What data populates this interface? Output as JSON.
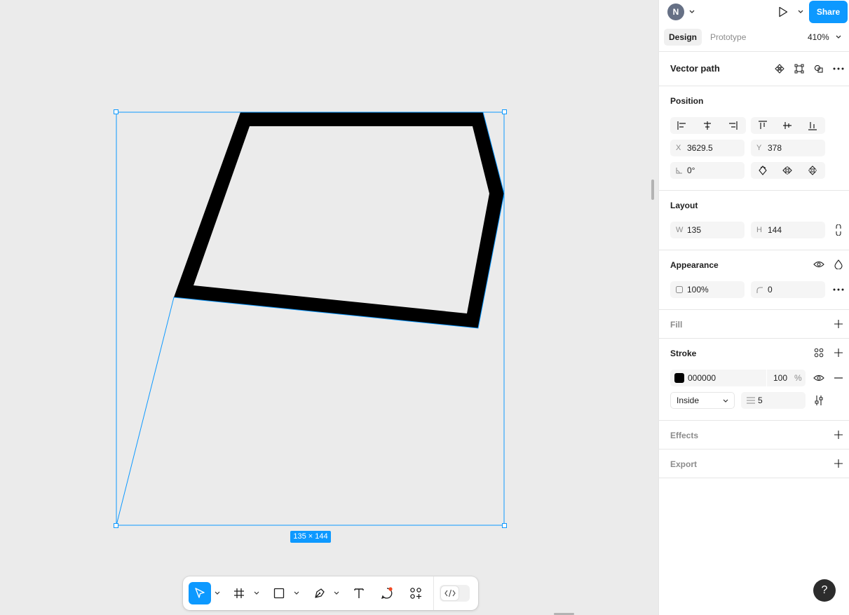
{
  "header": {
    "avatar_initial": "N",
    "share_label": "Share"
  },
  "tabs": [
    {
      "label": "Design",
      "active": true
    },
    {
      "label": "Prototype",
      "active": false
    }
  ],
  "zoom": "410%",
  "layer": {
    "title": "Vector path",
    "size_badge": "135 × 144"
  },
  "position": {
    "title": "Position",
    "x_label": "X",
    "x_value": "3629.5",
    "y_label": "Y",
    "y_value": "378",
    "rotation": "0°"
  },
  "layout": {
    "title": "Layout",
    "w_label": "W",
    "w_value": "135",
    "h_label": "H",
    "h_value": "144"
  },
  "appearance": {
    "title": "Appearance",
    "opacity": "100%",
    "radius": "0"
  },
  "fill": {
    "title": "Fill"
  },
  "stroke": {
    "title": "Stroke",
    "color_hex": "000000",
    "opacity": "100",
    "opacity_unit": "%",
    "position": "Inside",
    "weight": "5",
    "swatch_color": "#000000"
  },
  "effects": {
    "title": "Effects"
  },
  "export": {
    "title": "Export"
  },
  "colors": {
    "accent": "#0d99ff",
    "canvas": "#ebebeb"
  },
  "toolbar_icons": [
    "move-icon",
    "frame-icon",
    "rectangle-icon",
    "pen-icon",
    "text-icon",
    "comment-icon",
    "actions-icon",
    "dev-mode-icon"
  ]
}
